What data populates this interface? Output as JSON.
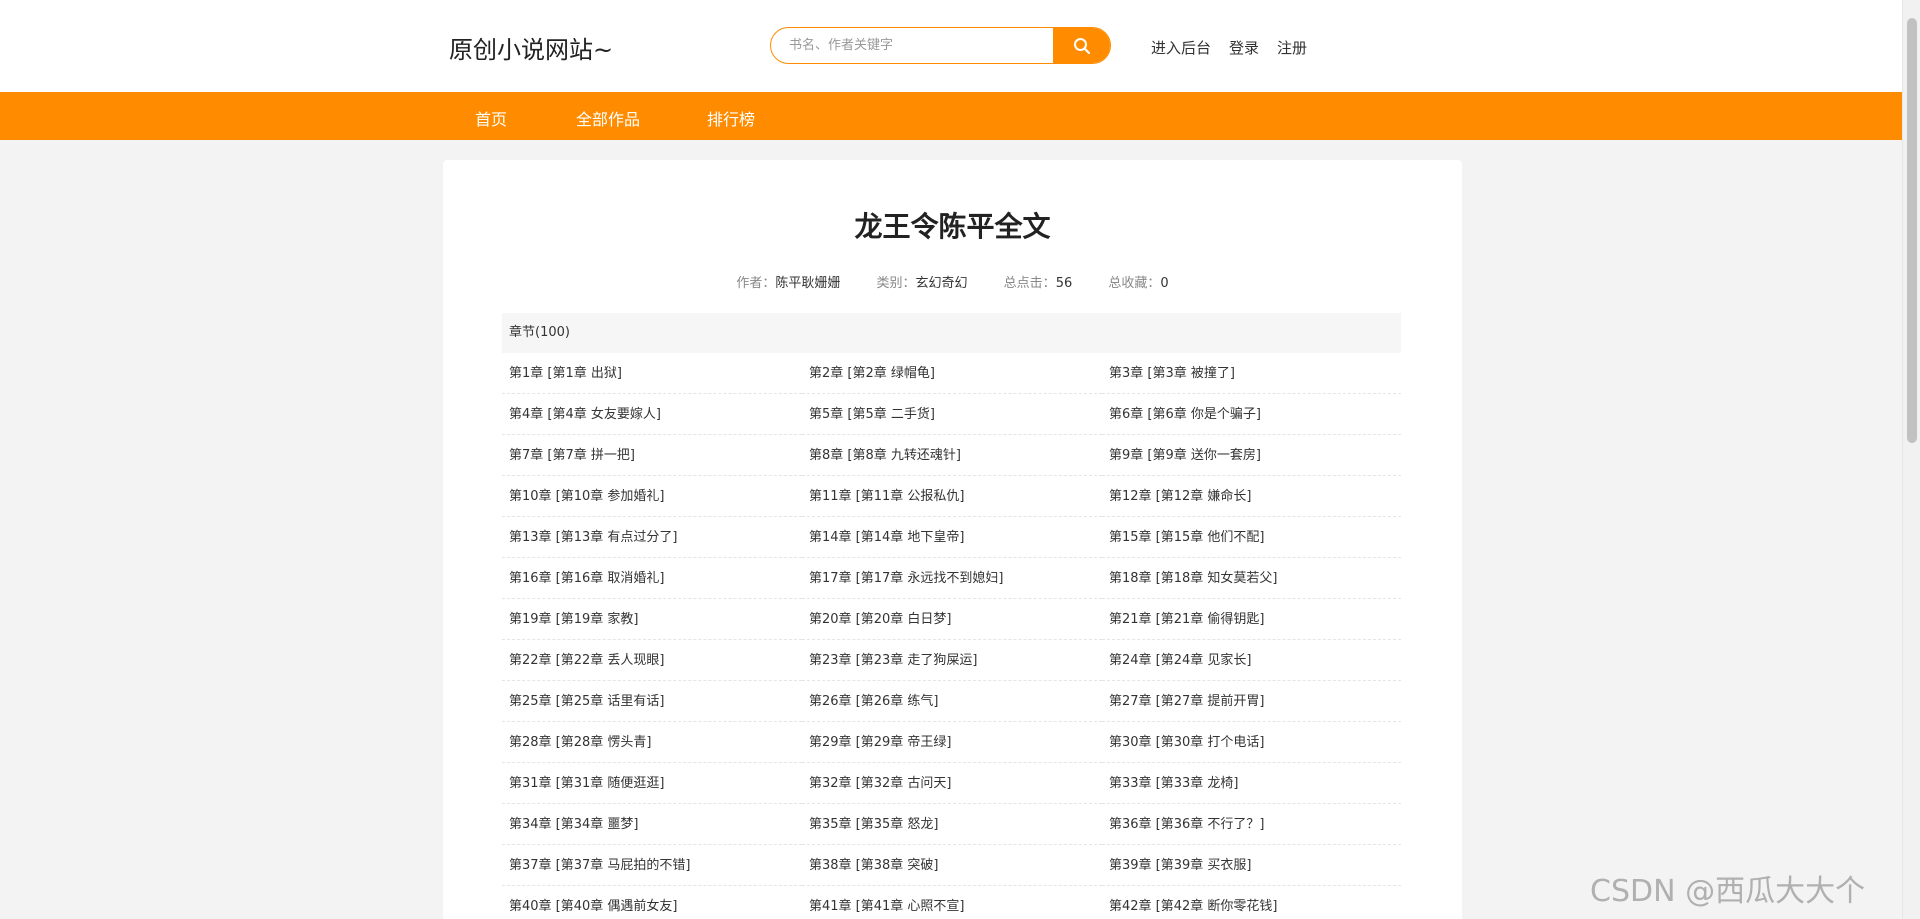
{
  "header": {
    "logo": "原创小说网站~",
    "search_placeholder": "书名、作者关键字",
    "search_value": "",
    "links": {
      "admin": "进入后台",
      "login": "登录",
      "register": "注册"
    }
  },
  "nav": {
    "home": "首页",
    "all_works": "全部作品",
    "ranking": "排行榜"
  },
  "book": {
    "title": "龙王令陈平全文",
    "author_label": "作者：",
    "author": "陈平耿姗姗",
    "category_label": "类别：",
    "category": "玄幻奇幻",
    "clicks_label": "总点击：",
    "clicks": "56",
    "favorites_label": "总收藏：",
    "favorites": "0"
  },
  "chapters_header": "章节(100)",
  "chapters": [
    "第1章 [第1章 出狱]",
    "第2章 [第2章 绿帽龟]",
    "第3章 [第3章 被撞了]",
    "第4章 [第4章 女友要嫁人]",
    "第5章 [第5章 二手货]",
    "第6章 [第6章 你是个骗子]",
    "第7章 [第7章 拼一把]",
    "第8章 [第8章 九转还魂针]",
    "第9章 [第9章 送你一套房]",
    "第10章 [第10章 参加婚礼]",
    "第11章 [第11章 公报私仇]",
    "第12章 [第12章 嫌命长]",
    "第13章 [第13章 有点过分了]",
    "第14章 [第14章 地下皇帝]",
    "第15章 [第15章 他们不配]",
    "第16章 [第16章 取消婚礼]",
    "第17章 [第17章 永远找不到媳妇]",
    "第18章 [第18章 知女莫若父]",
    "第19章 [第19章 家教]",
    "第20章 [第20章 白日梦]",
    "第21章 [第21章 偷得钥匙]",
    "第22章 [第22章 丢人现眼]",
    "第23章 [第23章 走了狗屎运]",
    "第24章 [第24章 见家长]",
    "第25章 [第25章 话里有话]",
    "第26章 [第26章 练气]",
    "第27章 [第27章 提前开胃]",
    "第28章 [第28章 愣头青]",
    "第29章 [第29章 帝王绿]",
    "第30章 [第30章 打个电话]",
    "第31章 [第31章 随便逛逛]",
    "第32章 [第32章 古问天]",
    "第33章 [第33章 龙椅]",
    "第34章 [第34章 噩梦]",
    "第35章 [第35章 怒龙]",
    "第36章 [第36章 不行了？]",
    "第37章 [第37章 马屁拍的不错]",
    "第38章 [第38章 突破]",
    "第39章 [第39章 买衣服]",
    "第40章 [第40章 偶遇前女友]",
    "第41章 [第41章 心照不宣]",
    "第42章 [第42章 断你零花钱]"
  ],
  "watermark": "CSDN @西瓜大大个",
  "colors": {
    "accent": "#ff8c00",
    "background": "#f3f3f3"
  }
}
